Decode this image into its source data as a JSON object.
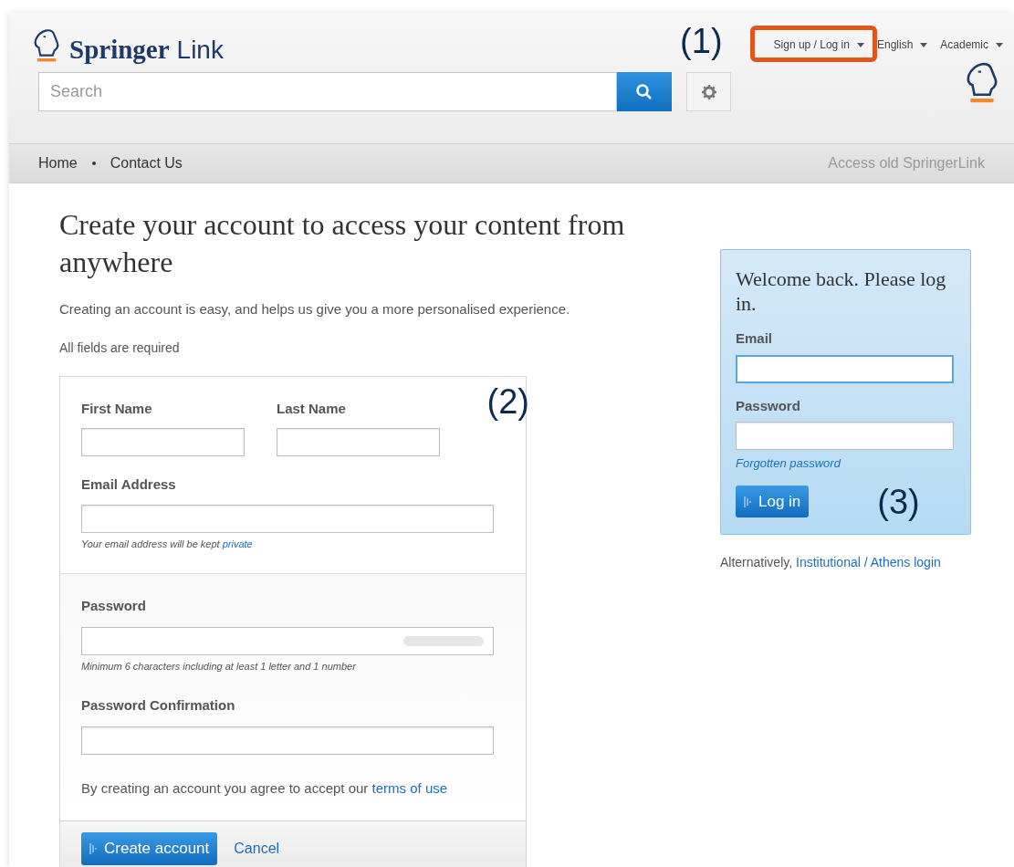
{
  "header": {
    "logo_text": "Springer",
    "logo_suffix": "Link",
    "top_menu": [
      {
        "label": "Sign up / Log in",
        "highlighted": true
      },
      {
        "label": "English",
        "highlighted": false
      },
      {
        "label": "Academic",
        "highlighted": false
      }
    ],
    "search": {
      "placeholder": "Search"
    }
  },
  "nav": {
    "items": [
      "Home",
      "Contact Us"
    ],
    "right_link": "Access old SpringerLink"
  },
  "signup": {
    "title": "Create your account to access your content from anywhere",
    "intro": "Creating an account is easy, and helps us give you a more personalised experience.",
    "required_note": "All fields are required",
    "fields": {
      "first_name": "First Name",
      "last_name": "Last Name",
      "email": "Email Address",
      "email_hint": "Your email address will be kept",
      "email_hint_link": "private",
      "password": "Password",
      "password_hint": "Minimum 6 characters including at least 1 letter and 1 number",
      "password_confirm": "Password Confirmation"
    },
    "terms": "By creating an account you agree to accept our",
    "terms_link": "terms of use",
    "submit": "Create account",
    "cancel": "Cancel"
  },
  "login": {
    "title": "Welcome back. Please log in.",
    "email_label": "Email",
    "password_label": "Password",
    "forgot": "Forgotten password",
    "submit": "Log in",
    "alt_text": "Alternatively,",
    "alt_link": "Institutional / Athens login"
  },
  "callouts": [
    "(1)",
    "(2)",
    "(3)"
  ]
}
